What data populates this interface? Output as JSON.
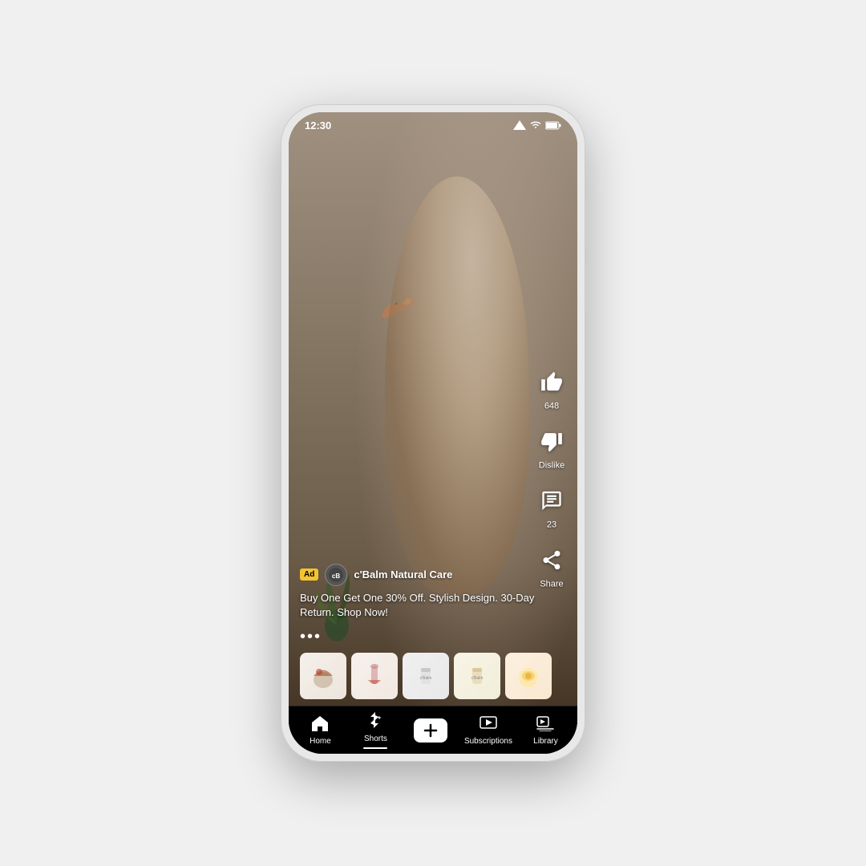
{
  "status": {
    "time": "12:30",
    "signal": "▼▲",
    "battery": "▮"
  },
  "actions": {
    "like_count": "648",
    "like_label": "Like",
    "dislike_label": "Dislike",
    "comment_count": "23",
    "share_label": "Share",
    "more_label": "..."
  },
  "ad": {
    "badge": "Ad",
    "advertiser": "c'Balm Natural Care",
    "description": "Buy One Get One 30% Off. Stylish Design. 30-Day Return. Shop Now!"
  },
  "nav": {
    "home": "Home",
    "shorts": "Shorts",
    "add": "+",
    "subscriptions": "Subscriptions",
    "library": "Library"
  },
  "icons": {
    "home": "⌂",
    "shorts_bolt": "⚡",
    "subscriptions": "▶",
    "library": "▤"
  }
}
